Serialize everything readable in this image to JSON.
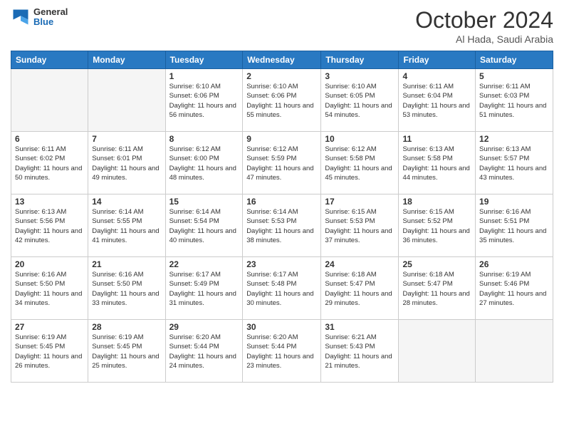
{
  "header": {
    "logo": {
      "general": "General",
      "blue": "Blue"
    },
    "title": "October 2024",
    "location": "Al Hada, Saudi Arabia"
  },
  "days_of_week": [
    "Sunday",
    "Monday",
    "Tuesday",
    "Wednesday",
    "Thursday",
    "Friday",
    "Saturday"
  ],
  "weeks": [
    [
      {
        "num": "",
        "sunrise": "",
        "sunset": "",
        "daylight": ""
      },
      {
        "num": "",
        "sunrise": "",
        "sunset": "",
        "daylight": ""
      },
      {
        "num": "1",
        "sunrise": "Sunrise: 6:10 AM",
        "sunset": "Sunset: 6:06 PM",
        "daylight": "Daylight: 11 hours and 56 minutes."
      },
      {
        "num": "2",
        "sunrise": "Sunrise: 6:10 AM",
        "sunset": "Sunset: 6:06 PM",
        "daylight": "Daylight: 11 hours and 55 minutes."
      },
      {
        "num": "3",
        "sunrise": "Sunrise: 6:10 AM",
        "sunset": "Sunset: 6:05 PM",
        "daylight": "Daylight: 11 hours and 54 minutes."
      },
      {
        "num": "4",
        "sunrise": "Sunrise: 6:11 AM",
        "sunset": "Sunset: 6:04 PM",
        "daylight": "Daylight: 11 hours and 53 minutes."
      },
      {
        "num": "5",
        "sunrise": "Sunrise: 6:11 AM",
        "sunset": "Sunset: 6:03 PM",
        "daylight": "Daylight: 11 hours and 51 minutes."
      }
    ],
    [
      {
        "num": "6",
        "sunrise": "Sunrise: 6:11 AM",
        "sunset": "Sunset: 6:02 PM",
        "daylight": "Daylight: 11 hours and 50 minutes."
      },
      {
        "num": "7",
        "sunrise": "Sunrise: 6:11 AM",
        "sunset": "Sunset: 6:01 PM",
        "daylight": "Daylight: 11 hours and 49 minutes."
      },
      {
        "num": "8",
        "sunrise": "Sunrise: 6:12 AM",
        "sunset": "Sunset: 6:00 PM",
        "daylight": "Daylight: 11 hours and 48 minutes."
      },
      {
        "num": "9",
        "sunrise": "Sunrise: 6:12 AM",
        "sunset": "Sunset: 5:59 PM",
        "daylight": "Daylight: 11 hours and 47 minutes."
      },
      {
        "num": "10",
        "sunrise": "Sunrise: 6:12 AM",
        "sunset": "Sunset: 5:58 PM",
        "daylight": "Daylight: 11 hours and 45 minutes."
      },
      {
        "num": "11",
        "sunrise": "Sunrise: 6:13 AM",
        "sunset": "Sunset: 5:58 PM",
        "daylight": "Daylight: 11 hours and 44 minutes."
      },
      {
        "num": "12",
        "sunrise": "Sunrise: 6:13 AM",
        "sunset": "Sunset: 5:57 PM",
        "daylight": "Daylight: 11 hours and 43 minutes."
      }
    ],
    [
      {
        "num": "13",
        "sunrise": "Sunrise: 6:13 AM",
        "sunset": "Sunset: 5:56 PM",
        "daylight": "Daylight: 11 hours and 42 minutes."
      },
      {
        "num": "14",
        "sunrise": "Sunrise: 6:14 AM",
        "sunset": "Sunset: 5:55 PM",
        "daylight": "Daylight: 11 hours and 41 minutes."
      },
      {
        "num": "15",
        "sunrise": "Sunrise: 6:14 AM",
        "sunset": "Sunset: 5:54 PM",
        "daylight": "Daylight: 11 hours and 40 minutes."
      },
      {
        "num": "16",
        "sunrise": "Sunrise: 6:14 AM",
        "sunset": "Sunset: 5:53 PM",
        "daylight": "Daylight: 11 hours and 38 minutes."
      },
      {
        "num": "17",
        "sunrise": "Sunrise: 6:15 AM",
        "sunset": "Sunset: 5:53 PM",
        "daylight": "Daylight: 11 hours and 37 minutes."
      },
      {
        "num": "18",
        "sunrise": "Sunrise: 6:15 AM",
        "sunset": "Sunset: 5:52 PM",
        "daylight": "Daylight: 11 hours and 36 minutes."
      },
      {
        "num": "19",
        "sunrise": "Sunrise: 6:16 AM",
        "sunset": "Sunset: 5:51 PM",
        "daylight": "Daylight: 11 hours and 35 minutes."
      }
    ],
    [
      {
        "num": "20",
        "sunrise": "Sunrise: 6:16 AM",
        "sunset": "Sunset: 5:50 PM",
        "daylight": "Daylight: 11 hours and 34 minutes."
      },
      {
        "num": "21",
        "sunrise": "Sunrise: 6:16 AM",
        "sunset": "Sunset: 5:50 PM",
        "daylight": "Daylight: 11 hours and 33 minutes."
      },
      {
        "num": "22",
        "sunrise": "Sunrise: 6:17 AM",
        "sunset": "Sunset: 5:49 PM",
        "daylight": "Daylight: 11 hours and 31 minutes."
      },
      {
        "num": "23",
        "sunrise": "Sunrise: 6:17 AM",
        "sunset": "Sunset: 5:48 PM",
        "daylight": "Daylight: 11 hours and 30 minutes."
      },
      {
        "num": "24",
        "sunrise": "Sunrise: 6:18 AM",
        "sunset": "Sunset: 5:47 PM",
        "daylight": "Daylight: 11 hours and 29 minutes."
      },
      {
        "num": "25",
        "sunrise": "Sunrise: 6:18 AM",
        "sunset": "Sunset: 5:47 PM",
        "daylight": "Daylight: 11 hours and 28 minutes."
      },
      {
        "num": "26",
        "sunrise": "Sunrise: 6:19 AM",
        "sunset": "Sunset: 5:46 PM",
        "daylight": "Daylight: 11 hours and 27 minutes."
      }
    ],
    [
      {
        "num": "27",
        "sunrise": "Sunrise: 6:19 AM",
        "sunset": "Sunset: 5:45 PM",
        "daylight": "Daylight: 11 hours and 26 minutes."
      },
      {
        "num": "28",
        "sunrise": "Sunrise: 6:19 AM",
        "sunset": "Sunset: 5:45 PM",
        "daylight": "Daylight: 11 hours and 25 minutes."
      },
      {
        "num": "29",
        "sunrise": "Sunrise: 6:20 AM",
        "sunset": "Sunset: 5:44 PM",
        "daylight": "Daylight: 11 hours and 24 minutes."
      },
      {
        "num": "30",
        "sunrise": "Sunrise: 6:20 AM",
        "sunset": "Sunset: 5:44 PM",
        "daylight": "Daylight: 11 hours and 23 minutes."
      },
      {
        "num": "31",
        "sunrise": "Sunrise: 6:21 AM",
        "sunset": "Sunset: 5:43 PM",
        "daylight": "Daylight: 11 hours and 21 minutes."
      },
      {
        "num": "",
        "sunrise": "",
        "sunset": "",
        "daylight": ""
      },
      {
        "num": "",
        "sunrise": "",
        "sunset": "",
        "daylight": ""
      }
    ]
  ]
}
